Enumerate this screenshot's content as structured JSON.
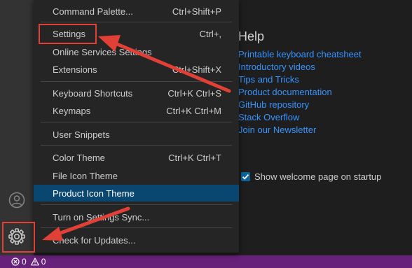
{
  "menu": {
    "items": [
      {
        "label": "Command Palette...",
        "shortcut": "Ctrl+Shift+P"
      },
      {
        "label": "Settings",
        "shortcut": "Ctrl+,"
      },
      {
        "label": "Online Services Settings",
        "shortcut": ""
      },
      {
        "label": "Extensions",
        "shortcut": "Ctrl+Shift+X"
      },
      {
        "label": "Keyboard Shortcuts",
        "shortcut": "Ctrl+K Ctrl+S"
      },
      {
        "label": "Keymaps",
        "shortcut": "Ctrl+K Ctrl+M"
      },
      {
        "label": "User Snippets",
        "shortcut": ""
      },
      {
        "label": "Color Theme",
        "shortcut": "Ctrl+K Ctrl+T"
      },
      {
        "label": "File Icon Theme",
        "shortcut": ""
      },
      {
        "label": "Product Icon Theme",
        "shortcut": ""
      },
      {
        "label": "Turn on Settings Sync...",
        "shortcut": ""
      },
      {
        "label": "Check for Updates...",
        "shortcut": ""
      }
    ]
  },
  "welcome": {
    "help_title": "Help",
    "links": [
      "Printable keyboard cheatsheet",
      "Introductory videos",
      "Tips and Tricks",
      "Product documentation",
      "GitHub repository",
      "Stack Overflow",
      "Join our Newsletter"
    ],
    "startup_label": "Show welcome page on startup",
    "startup_checked": true
  },
  "status_bar": {
    "errors": "0",
    "warnings": "0"
  },
  "icons": {
    "account": "account-icon",
    "manage": "gear-icon",
    "errors": "error-icon",
    "warnings": "warning-icon"
  },
  "colors": {
    "status_bar": "#68217a",
    "active_item": "#094771",
    "link": "#3794ff",
    "annotation": "#e04035"
  }
}
